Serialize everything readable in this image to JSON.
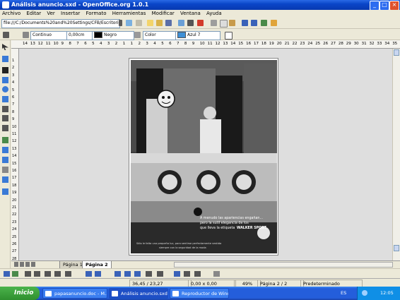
{
  "window": {
    "title": "Análisis anuncio.sxd - OpenOffice.org 1.0.1"
  },
  "menu": [
    "Archivo",
    "Editar",
    "Ver",
    "Insertar",
    "Formato",
    "Herramientas",
    "Modificar",
    "Ventana",
    "Ayuda"
  ],
  "url_field": "file:///C:/Documents%20and%20Settings/CFB/Escritorio/...",
  "object_bar": {
    "line_style": "Continuo",
    "line_width": "0,00cm",
    "line_color": "Negro",
    "area_style": "Color",
    "area_color": "Azul 7",
    "line_color_hex": "#000000",
    "area_color_hex": "#3d8fd6"
  },
  "ruler_h": [
    "14",
    "13",
    "12",
    "11",
    "10",
    "9",
    "8",
    "7",
    "6",
    "5",
    "4",
    "3",
    "2",
    "1",
    "1",
    "2",
    "3",
    "4",
    "5",
    "6",
    "7",
    "8",
    "9",
    "10",
    "11",
    "12",
    "13",
    "14",
    "15",
    "16",
    "17",
    "18",
    "19",
    "20",
    "21",
    "22",
    "23",
    "24",
    "25",
    "26",
    "27",
    "28",
    "29",
    "30",
    "31",
    "32",
    "33",
    "34",
    "35",
    "36"
  ],
  "ruler_v": [
    "1",
    "2",
    "3",
    "4",
    "5",
    "6",
    "7",
    "8",
    "9",
    "10",
    "11",
    "12",
    "13",
    "14",
    "15",
    "16",
    "17",
    "18",
    "19",
    "20",
    "21",
    "22",
    "23",
    "24",
    "25",
    "26",
    "27",
    "28"
  ],
  "ad": {
    "line1": "A menudo las apariencias engañan...",
    "line2": "pero la sutil elegancia de los",
    "line3": "que lleva la etiqueta",
    "brand": "WALKER SPORT",
    "footer1": "Sólo le falta una pequeña luz, para sentirse perfectamente vestida",
    "footer2": "siempre con la seguridad de la moda"
  },
  "tabs": [
    "Página 1",
    "Página 2"
  ],
  "status": {
    "position": "36,45 / 23,27",
    "size": "0,00 x 0,00",
    "zoom": "49%",
    "page": "Página 2 / 2",
    "layout": "Predeterminado"
  },
  "taskbar": {
    "start": "Inicio",
    "tasks": [
      "papasanuncio.doc - M...",
      "Análisis anuncio.sxd -...",
      "Reproductor de Wind..."
    ],
    "lang": "ES",
    "clock": "12:05"
  }
}
